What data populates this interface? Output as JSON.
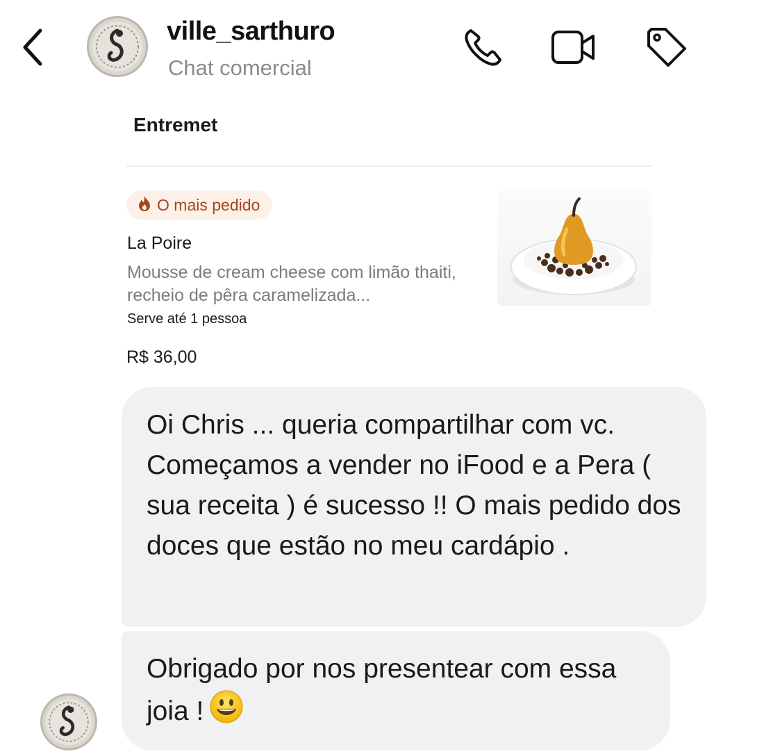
{
  "header": {
    "username": "ville_sarthuro",
    "subtitle": "Chat comercial",
    "icons": [
      "back-chevron-icon",
      "phone-icon",
      "video-camera-icon",
      "tag-icon"
    ]
  },
  "shared_item": {
    "section_title": "Entremet",
    "badge_label": "O mais pedido",
    "badge_icon": "fire-icon",
    "name": "La Poire",
    "description": "Mousse de cream cheese com limão thaiti, recheio de pêra caramelizada...",
    "serves": "Serve até 1 pessoa",
    "price": "R$ 36,00"
  },
  "messages": [
    {
      "text": "Oi Chris ... queria compartilhar com vc. Começamos a vender no iFood e a Pera ( sua receita ) é sucesso !! O mais pedido dos doces que estão no meu cardápio ."
    },
    {
      "text": "Obrigado por nos presentear com essa joia !",
      "emoji": "grinning-face-emoji"
    }
  ],
  "colors": {
    "bubble": "#f1f1f3",
    "badge_bg": "#fdf0e8",
    "badge_text": "#a2461a",
    "secondary_text": "#8a8a8a"
  }
}
